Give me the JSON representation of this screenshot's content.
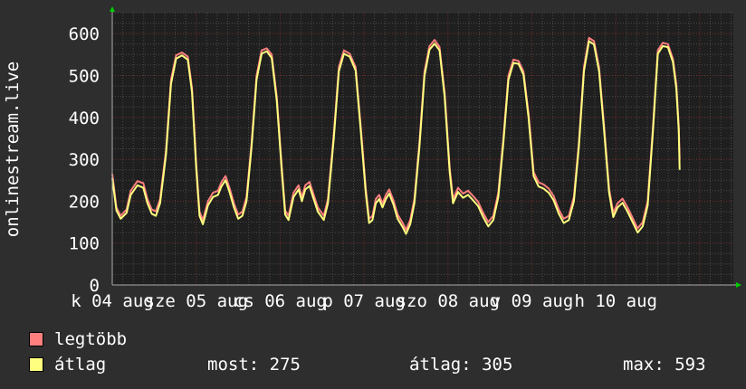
{
  "chart_data": {
    "type": "line",
    "ylabel": "onlinestream.live",
    "ylim": [
      0,
      650
    ],
    "yticks": [
      0,
      100,
      200,
      300,
      400,
      500,
      600
    ],
    "grid": true,
    "xtick_labels": [
      "k 04 aug",
      "sze 05 aug",
      "cs 06 aug",
      "p 07 aug",
      "szo 08 aug",
      "v 09 aug",
      "h 10 aug"
    ],
    "x_range_days": [
      0,
      7.4
    ],
    "series": [
      {
        "name": "legtöbb",
        "color": "#ff7f7f",
        "points": [
          [
            0.0,
            265
          ],
          [
            0.05,
            185
          ],
          [
            0.1,
            165
          ],
          [
            0.17,
            180
          ],
          [
            0.22,
            225
          ],
          [
            0.3,
            248
          ],
          [
            0.37,
            243
          ],
          [
            0.42,
            205
          ],
          [
            0.47,
            180
          ],
          [
            0.52,
            176
          ],
          [
            0.57,
            205
          ],
          [
            0.64,
            320
          ],
          [
            0.7,
            490
          ],
          [
            0.76,
            548
          ],
          [
            0.83,
            555
          ],
          [
            0.9,
            545
          ],
          [
            0.95,
            470
          ],
          [
            1.0,
            290
          ],
          [
            1.04,
            175
          ],
          [
            1.08,
            155
          ],
          [
            1.14,
            200
          ],
          [
            1.2,
            220
          ],
          [
            1.26,
            225
          ],
          [
            1.3,
            245
          ],
          [
            1.35,
            260
          ],
          [
            1.4,
            230
          ],
          [
            1.45,
            195
          ],
          [
            1.5,
            168
          ],
          [
            1.55,
            175
          ],
          [
            1.6,
            210
          ],
          [
            1.66,
            340
          ],
          [
            1.72,
            500
          ],
          [
            1.78,
            560
          ],
          [
            1.84,
            565
          ],
          [
            1.9,
            550
          ],
          [
            1.96,
            450
          ],
          [
            2.02,
            280
          ],
          [
            2.06,
            178
          ],
          [
            2.1,
            165
          ],
          [
            2.16,
            220
          ],
          [
            2.22,
            238
          ],
          [
            2.26,
            210
          ],
          [
            2.3,
            238
          ],
          [
            2.35,
            246
          ],
          [
            2.4,
            215
          ],
          [
            2.45,
            185
          ],
          [
            2.52,
            165
          ],
          [
            2.57,
            205
          ],
          [
            2.64,
            360
          ],
          [
            2.7,
            520
          ],
          [
            2.76,
            560
          ],
          [
            2.83,
            552
          ],
          [
            2.9,
            520
          ],
          [
            2.96,
            380
          ],
          [
            3.02,
            230
          ],
          [
            3.06,
            158
          ],
          [
            3.1,
            165
          ],
          [
            3.14,
            205
          ],
          [
            3.18,
            215
          ],
          [
            3.22,
            195
          ],
          [
            3.26,
            215
          ],
          [
            3.3,
            228
          ],
          [
            3.35,
            202
          ],
          [
            3.4,
            168
          ],
          [
            3.46,
            148
          ],
          [
            3.5,
            132
          ],
          [
            3.55,
            155
          ],
          [
            3.6,
            205
          ],
          [
            3.66,
            340
          ],
          [
            3.72,
            510
          ],
          [
            3.78,
            570
          ],
          [
            3.84,
            585
          ],
          [
            3.9,
            568
          ],
          [
            3.96,
            460
          ],
          [
            4.02,
            280
          ],
          [
            4.06,
            205
          ],
          [
            4.12,
            232
          ],
          [
            4.18,
            218
          ],
          [
            4.24,
            225
          ],
          [
            4.3,
            212
          ],
          [
            4.36,
            198
          ],
          [
            4.42,
            172
          ],
          [
            4.48,
            150
          ],
          [
            4.54,
            165
          ],
          [
            4.6,
            220
          ],
          [
            4.66,
            350
          ],
          [
            4.72,
            500
          ],
          [
            4.78,
            538
          ],
          [
            4.84,
            535
          ],
          [
            4.9,
            510
          ],
          [
            4.96,
            410
          ],
          [
            5.02,
            270
          ],
          [
            5.08,
            245
          ],
          [
            5.14,
            240
          ],
          [
            5.2,
            230
          ],
          [
            5.26,
            212
          ],
          [
            5.32,
            180
          ],
          [
            5.38,
            158
          ],
          [
            5.44,
            165
          ],
          [
            5.5,
            210
          ],
          [
            5.56,
            340
          ],
          [
            5.62,
            520
          ],
          [
            5.68,
            590
          ],
          [
            5.74,
            582
          ],
          [
            5.8,
            520
          ],
          [
            5.86,
            380
          ],
          [
            5.92,
            230
          ],
          [
            5.97,
            172
          ],
          [
            6.02,
            195
          ],
          [
            6.08,
            206
          ],
          [
            6.14,
            185
          ],
          [
            6.2,
            160
          ],
          [
            6.26,
            135
          ],
          [
            6.32,
            150
          ],
          [
            6.38,
            200
          ],
          [
            6.44,
            370
          ],
          [
            6.5,
            560
          ],
          [
            6.56,
            578
          ],
          [
            6.62,
            575
          ],
          [
            6.68,
            540
          ],
          [
            6.72,
            480
          ],
          [
            6.75,
            380
          ],
          [
            6.76,
            300
          ]
        ]
      },
      {
        "name": "átlag",
        "color": "#ffff7f",
        "points": [
          [
            0.0,
            255
          ],
          [
            0.05,
            178
          ],
          [
            0.1,
            158
          ],
          [
            0.17,
            172
          ],
          [
            0.22,
            215
          ],
          [
            0.3,
            238
          ],
          [
            0.37,
            232
          ],
          [
            0.42,
            195
          ],
          [
            0.47,
            170
          ],
          [
            0.52,
            165
          ],
          [
            0.57,
            195
          ],
          [
            0.64,
            310
          ],
          [
            0.7,
            480
          ],
          [
            0.76,
            540
          ],
          [
            0.83,
            548
          ],
          [
            0.9,
            538
          ],
          [
            0.95,
            460
          ],
          [
            1.0,
            280
          ],
          [
            1.04,
            165
          ],
          [
            1.08,
            145
          ],
          [
            1.14,
            190
          ],
          [
            1.2,
            210
          ],
          [
            1.26,
            215
          ],
          [
            1.3,
            235
          ],
          [
            1.35,
            250
          ],
          [
            1.4,
            220
          ],
          [
            1.45,
            185
          ],
          [
            1.5,
            158
          ],
          [
            1.55,
            165
          ],
          [
            1.6,
            200
          ],
          [
            1.66,
            330
          ],
          [
            1.72,
            490
          ],
          [
            1.78,
            552
          ],
          [
            1.84,
            558
          ],
          [
            1.9,
            542
          ],
          [
            1.96,
            440
          ],
          [
            2.02,
            270
          ],
          [
            2.06,
            168
          ],
          [
            2.1,
            155
          ],
          [
            2.16,
            210
          ],
          [
            2.22,
            228
          ],
          [
            2.26,
            200
          ],
          [
            2.3,
            228
          ],
          [
            2.35,
            236
          ],
          [
            2.4,
            205
          ],
          [
            2.45,
            175
          ],
          [
            2.52,
            155
          ],
          [
            2.57,
            195
          ],
          [
            2.64,
            350
          ],
          [
            2.7,
            510
          ],
          [
            2.76,
            552
          ],
          [
            2.83,
            545
          ],
          [
            2.9,
            512
          ],
          [
            2.96,
            370
          ],
          [
            3.02,
            220
          ],
          [
            3.06,
            148
          ],
          [
            3.1,
            155
          ],
          [
            3.14,
            195
          ],
          [
            3.18,
            205
          ],
          [
            3.22,
            185
          ],
          [
            3.26,
            205
          ],
          [
            3.3,
            218
          ],
          [
            3.35,
            192
          ],
          [
            3.4,
            158
          ],
          [
            3.46,
            138
          ],
          [
            3.5,
            122
          ],
          [
            3.55,
            145
          ],
          [
            3.6,
            195
          ],
          [
            3.66,
            330
          ],
          [
            3.72,
            500
          ],
          [
            3.78,
            562
          ],
          [
            3.84,
            576
          ],
          [
            3.9,
            560
          ],
          [
            3.96,
            450
          ],
          [
            4.02,
            270
          ],
          [
            4.06,
            195
          ],
          [
            4.12,
            222
          ],
          [
            4.18,
            208
          ],
          [
            4.24,
            215
          ],
          [
            4.3,
            202
          ],
          [
            4.36,
            188
          ],
          [
            4.42,
            162
          ],
          [
            4.48,
            140
          ],
          [
            4.54,
            155
          ],
          [
            4.6,
            210
          ],
          [
            4.66,
            340
          ],
          [
            4.72,
            490
          ],
          [
            4.78,
            530
          ],
          [
            4.84,
            528
          ],
          [
            4.9,
            502
          ],
          [
            4.96,
            400
          ],
          [
            5.02,
            260
          ],
          [
            5.08,
            235
          ],
          [
            5.14,
            230
          ],
          [
            5.2,
            220
          ],
          [
            5.26,
            202
          ],
          [
            5.32,
            170
          ],
          [
            5.38,
            148
          ],
          [
            5.44,
            155
          ],
          [
            5.5,
            200
          ],
          [
            5.56,
            330
          ],
          [
            5.62,
            510
          ],
          [
            5.68,
            582
          ],
          [
            5.74,
            574
          ],
          [
            5.8,
            510
          ],
          [
            5.86,
            370
          ],
          [
            5.92,
            220
          ],
          [
            5.97,
            162
          ],
          [
            6.02,
            185
          ],
          [
            6.08,
            196
          ],
          [
            6.14,
            175
          ],
          [
            6.2,
            150
          ],
          [
            6.26,
            125
          ],
          [
            6.32,
            140
          ],
          [
            6.38,
            190
          ],
          [
            6.44,
            360
          ],
          [
            6.5,
            552
          ],
          [
            6.56,
            570
          ],
          [
            6.62,
            568
          ],
          [
            6.68,
            532
          ],
          [
            6.72,
            470
          ],
          [
            6.75,
            370
          ],
          [
            6.76,
            275
          ]
        ]
      }
    ]
  },
  "legend": [
    {
      "label": "legtöbb",
      "color": "#ff7f7f"
    },
    {
      "label": "átlag",
      "color": "#ffff7f"
    }
  ],
  "stats": {
    "most": "most: 275",
    "atlag": "átlag: 305",
    "max": "max: 593"
  }
}
